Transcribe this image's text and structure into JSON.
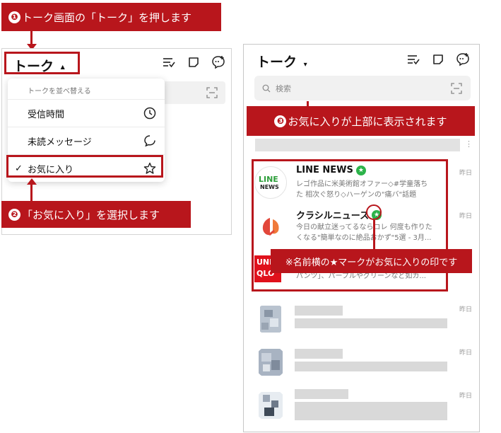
{
  "callouts": {
    "step1": {
      "num": "❶",
      "text": "トーク画面の「トーク」を押します"
    },
    "step2": {
      "num": "❷",
      "text": "「お気に入り」を選択します"
    },
    "step3": {
      "num": "❸",
      "text": "お気に入りが上部に表示されます"
    },
    "note": "※名前横の★マークがお気に入りの印です"
  },
  "left": {
    "title": "トーク",
    "caret": "▲",
    "menu": {
      "header": "トークを並べ替える",
      "items": [
        {
          "label": "受信時間",
          "icon": "clock-icon"
        },
        {
          "label": "未読メッセージ",
          "icon": "speech-bubble-icon"
        },
        {
          "label": "お気に入り",
          "icon": "star-icon",
          "selected": true,
          "check": "✓"
        }
      ]
    }
  },
  "right": {
    "title": "トーク",
    "caret": "▾",
    "search_placeholder": "検索",
    "chats": [
      {
        "name": "LINE NEWS",
        "favorite": true,
        "time": "昨日",
        "line1": "レゴ作品に米美術館オファー◇#学童落ち",
        "line2": "た 相次ぐ怒り◇ハーゲンの\"痛バ\"話題"
      },
      {
        "name": "クラシルニュース",
        "favorite": true,
        "time": "昨日",
        "line1": "今日の献立迷ってるならコレ 何度も作りた",
        "line2": "くなる\"簡単なのに絶品おかず\"5選 - 3月..."
      },
      {
        "name": "",
        "favorite": true,
        "time": "",
        "line1": "",
        "line2": "パンツ」、パープルやグリーンなど如カ..."
      },
      {
        "name": "",
        "time": "昨日"
      },
      {
        "name": "",
        "time": "昨日"
      },
      {
        "name": "",
        "time": "昨日"
      }
    ],
    "avatar_labels": {
      "line_news_top": "LINE",
      "line_news_bottom": "NEWS",
      "uniqlo_top": "UNI",
      "uniqlo_bottom": "QLO"
    },
    "star_glyph": "★"
  },
  "colors": {
    "accent": "#b8161c",
    "favorite": "#2cb34a"
  }
}
